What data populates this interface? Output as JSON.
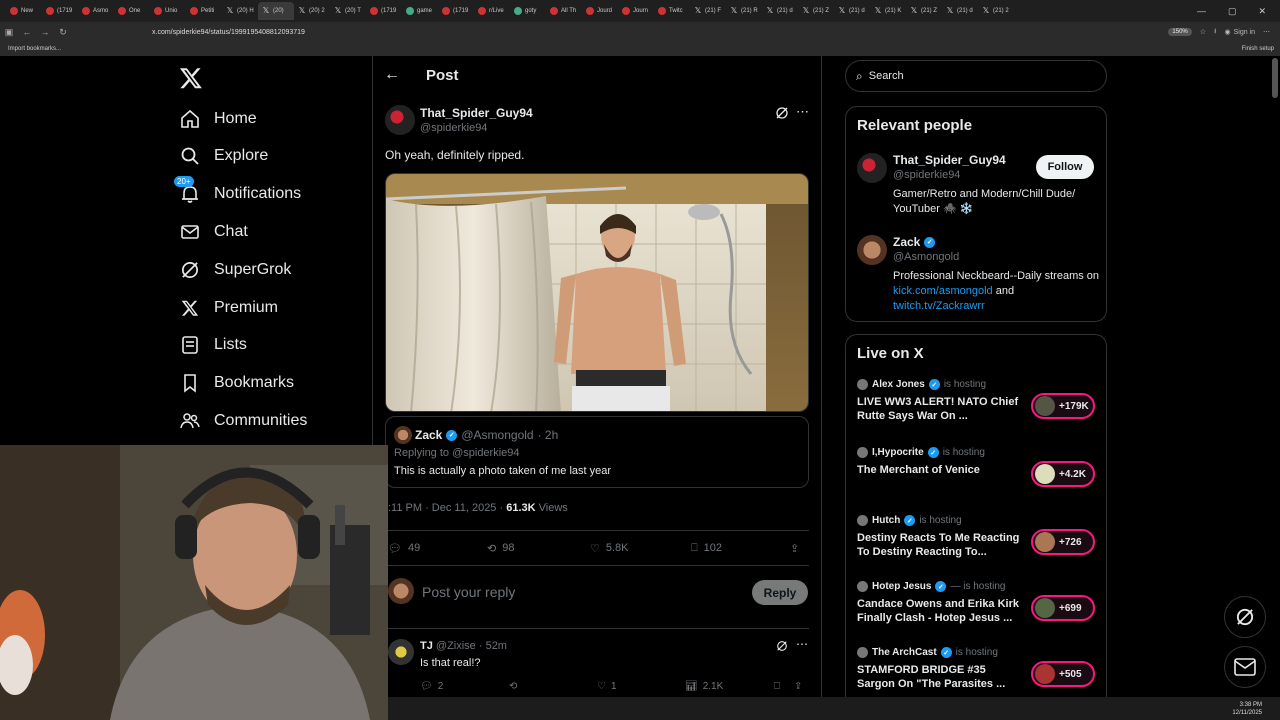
{
  "browser": {
    "tabs": [
      "New",
      "(1719",
      "Asmo",
      "One",
      "Unio",
      "Petiti",
      "(20) H",
      "(20)",
      "(20) 2",
      "(20) T",
      "(1719",
      "game",
      "(1719",
      "r/Live",
      "goty",
      "All Th",
      "Jourd",
      "Journ",
      "Twitc",
      "(21) F",
      "(21) R",
      "(21) d",
      "(21) Z",
      "(21) d",
      "(21) K",
      "(21) Z",
      "(21) d",
      "(21) 2"
    ],
    "url": "x.com/spiderkie94/status/1999195408812093719",
    "zoom": "150%",
    "sign_in": "Sign in",
    "bookmarks_label": "Import bookmarks...",
    "finish_setup": "Finish setup"
  },
  "nav": {
    "items": [
      {
        "label": "Home",
        "icon": "home-icon"
      },
      {
        "label": "Explore",
        "icon": "search-icon"
      },
      {
        "label": "Notifications",
        "icon": "bell-icon",
        "badge": "20+"
      },
      {
        "label": "Chat",
        "icon": "mail-icon"
      },
      {
        "label": "SuperGrok",
        "icon": "grok-icon"
      },
      {
        "label": "Premium",
        "icon": "x-logo-icon"
      },
      {
        "label": "Lists",
        "icon": "list-icon"
      },
      {
        "label": "Bookmarks",
        "icon": "bookmark-icon"
      },
      {
        "label": "Communities",
        "icon": "people-icon"
      }
    ]
  },
  "post": {
    "header": "Post",
    "author_name": "That_Spider_Guy94",
    "author_handle": "@spiderkie94",
    "text": "Oh yeah, definitely ripped.",
    "quoted_reply": {
      "name": "Zack",
      "handle": "@Asmongold",
      "age": "· 2h",
      "replying_to": "Replying to @spiderkie94",
      "text": "This is actually a photo taken of me last year"
    },
    "time": ":11 PM · Dec 11, 2025 · ",
    "views_count": "61.3K",
    "views_label": " Views",
    "stats": {
      "replies": "49",
      "reposts": "98",
      "likes": "5.8K",
      "bookmarks": "102"
    },
    "reply_placeholder": "Post your reply",
    "reply_button": "Reply"
  },
  "comment": {
    "name": "TJ",
    "handle": "@Zixise · 52m",
    "text": "Is that real!?",
    "stats": {
      "replies": "2",
      "likes": "1",
      "views": "2.1K"
    }
  },
  "right": {
    "search_placeholder": "Search",
    "relevant_title": "Relevant people",
    "people": [
      {
        "name": "That_Spider_Guy94",
        "handle": "@spiderkie94",
        "bio": "Gamer/Retro and Modern/Chill Dude/ YouTuber 🕷️ ❄️",
        "follow": "Follow"
      },
      {
        "name": "Zack",
        "handle": "@Asmongold",
        "bio_pre": "Professional Neckbeard--Daily streams on ",
        "bio_link1": "kick.com/asmongold",
        "bio_mid": " and ",
        "bio_link2": "twitch.tv/Zackrawrr"
      }
    ],
    "live_title": "Live on X",
    "live": [
      {
        "host": "Alex Jones",
        "status": "is hosting",
        "title": "LIVE WW3 ALERT! NATO Chief Rutte Says War On ...",
        "count": "+179K"
      },
      {
        "host": "I,Hypocrite",
        "status": "is hosting",
        "title": "The Merchant of Venice",
        "count": "+4.2K"
      },
      {
        "host": "Hutch",
        "status": "is hosting",
        "title": "Destiny Reacts To Me Reacting To Destiny Reacting To...",
        "count": "+726"
      },
      {
        "host": "Hotep Jesus",
        "status": "— is hosting",
        "title": "Candace Owens and Erika Kirk Finally Clash - Hotep Jesus ...",
        "count": "+699"
      },
      {
        "host": "The ArchCast",
        "status": "is hosting",
        "title": "STAMFORD BRIDGE #35 Sargon On \"The Parasites ...",
        "count": "+505"
      }
    ]
  },
  "taskbar": {
    "time": "3:38 PM",
    "date": "12/11/2025"
  },
  "colors": {
    "accent": "#1d9bf0",
    "live_border": "#f91880",
    "background": "#000000"
  }
}
